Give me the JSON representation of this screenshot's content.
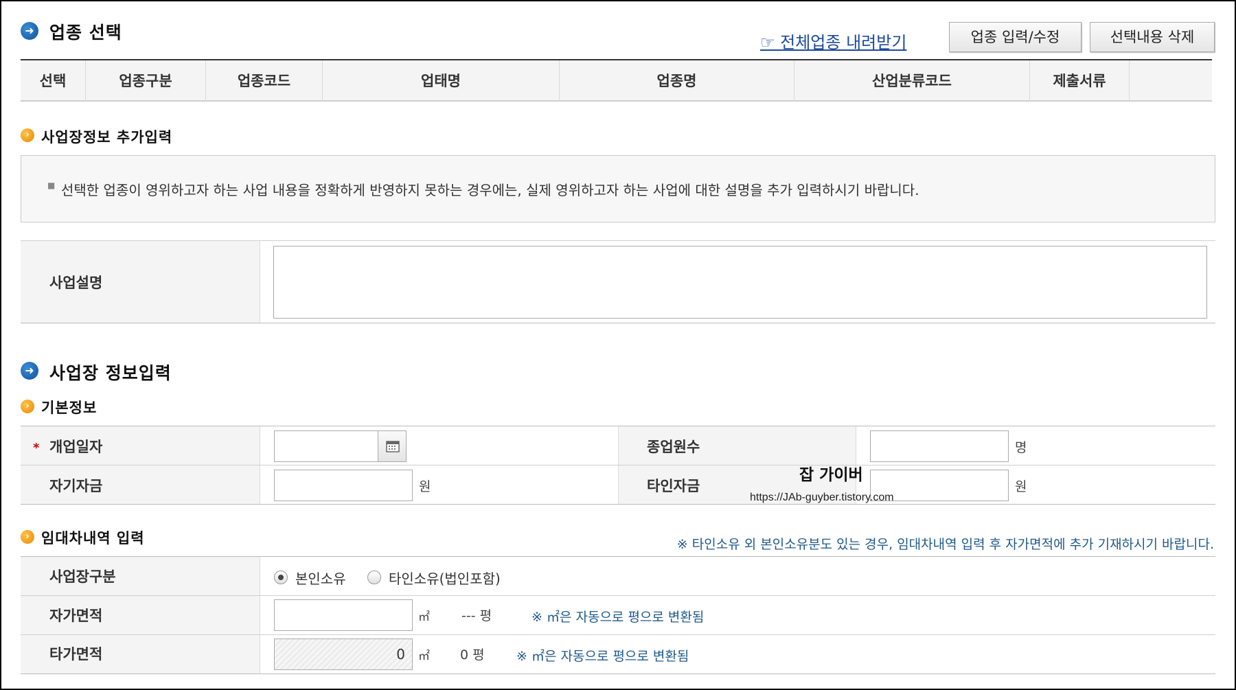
{
  "industry_section": {
    "title": "업종 선택",
    "download_link": "☞ 전체업종 내려받기",
    "btn_edit": "업종 입력/수정",
    "btn_delete": "선택내용 삭제",
    "columns": [
      "선택",
      "업종구분",
      "업종코드",
      "업태명",
      "업종명",
      "산업분류코드",
      "제출서류"
    ]
  },
  "extra_info": {
    "title": "사업장정보 추가입력",
    "notice": "선택한 업종이 영위하고자 하는 사업 내용을 정확하게 반영하지 못하는 경우에는, 실제 영위하고자 하는 사업에 대한 설명을 추가 입력하시기 바랍니다.",
    "desc_label": "사업설명",
    "desc_value": ""
  },
  "biz_section": {
    "title": "사업장 정보입력",
    "basic_title": "기본정보",
    "required_mark": "*",
    "open_date_label": "개업일자",
    "open_date_value": "",
    "employees_label": "종업원수",
    "employees_value": "",
    "employees_unit": "명",
    "own_capital_label": "자기자금",
    "own_capital_value": "",
    "own_capital_unit": "원",
    "other_capital_label": "타인자금",
    "other_capital_value": "",
    "other_capital_unit": "원"
  },
  "watermark": {
    "title": "잡 가이버",
    "url": "https://JAb-guyber.tistory.com"
  },
  "lease_section": {
    "title": "임대차내역 입력",
    "note": "※ 타인소유 외 본인소유분도 있는 경우, 임대차내역 입력 후 자가면적에 추가 기재하시기 바랍니다.",
    "type_label": "사업장구분",
    "option_own": "본인소유",
    "option_other": "타인소유(법인포함)",
    "selected": "본인소유",
    "own_area_label": "자가면적",
    "own_area_value": "",
    "area_unit": "㎡",
    "own_pyeong": "--- 평",
    "auto_note": "※ ㎡은 자동으로 평으로 변환됨",
    "other_area_label": "타가면적",
    "other_area_value": "0",
    "other_pyeong": "0 평"
  },
  "icons": {
    "section_arrow": "arrow-right-circle-icon",
    "sub_arrow": "chevron-right-circle-icon",
    "calendar": "calendar-icon"
  },
  "colors": {
    "link_blue": "#1c4a9c",
    "note_blue": "#1f5a8c",
    "required_red": "#cc0000"
  }
}
